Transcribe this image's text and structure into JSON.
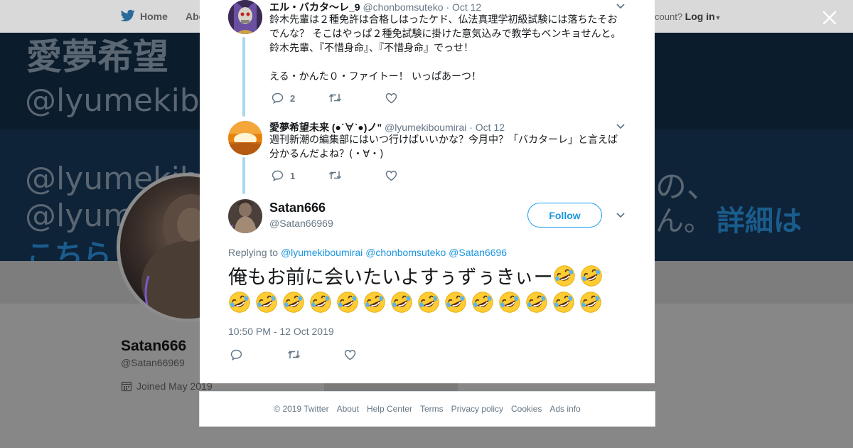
{
  "background": {
    "nav": {
      "home_label": "Home",
      "about_label": "Abo",
      "have_account": "count?",
      "login_label": "Log in"
    },
    "banner": {
      "line1": "愛夢希望",
      "line2": "@lyumekiboumirai",
      "line3": "@lyumekibo",
      "line3_right": "の、",
      "line4": "@lyume",
      "line4_right": "ん。",
      "line4_link": "詳細は",
      "line5_link": "こちら"
    },
    "profile": {
      "name": "Satan666",
      "handle": "@Satan66969",
      "joined": "Joined May 2019",
      "ads_info": "Ads info"
    }
  },
  "modal": {
    "tweets": [
      {
        "name": "エル・バカタ～レ_9",
        "handle": "@chonbomsuteko",
        "date": "· Oct 12",
        "text": "鈴木先輩は２種免許は合格しはったケド、仏法真理学初級試験には落ちたそおでんな？ そこはやっぱ２種免試験に掛けた意気込みで教学もベンキョせんと。\n鈴木先輩、『不惜身命』、『不惜身命』でっせ！\n\nえる・かんた０・ファイトー！ いっぱあーつ！",
        "reply_count": "2",
        "avatar_icon": "skeleton-avatar"
      },
      {
        "name": "愛夢希望未来 (●ˊ∀ˋ●)ノ\"",
        "handle": "@lyumekiboumirai",
        "date": "· Oct 12",
        "text": "週刊新潮の編集部にはいつ行けばいいかな？今月中？「バカターレ」と言えば分かるんだよね？(・∀・)",
        "reply_count": "1",
        "avatar_icon": "sunset-avatar"
      }
    ],
    "main_tweet": {
      "name": "Satan666",
      "handle": "@Satan66969",
      "follow_label": "Follow",
      "replying_to_label": "Replying to",
      "mentions": [
        "@lyumekiboumirai",
        "@chonbomsuteko",
        "@Satan6696"
      ],
      "text": "俺もお前に会いたいよすぅずぅきぃー",
      "emoji_count": 16,
      "emoji_name": "rolling-on-the-floor-laughing",
      "timestamp": "10:50 PM - 12 Oct 2019"
    }
  },
  "footer": {
    "links": [
      "© 2019 Twitter",
      "About",
      "Help Center",
      "Terms",
      "Privacy policy",
      "Cookies",
      "Ads info"
    ]
  },
  "colors": {
    "accent": "#1da1f2",
    "link": "#1b95e0",
    "muted": "#657786",
    "thread_line": "#a7d7f1"
  }
}
